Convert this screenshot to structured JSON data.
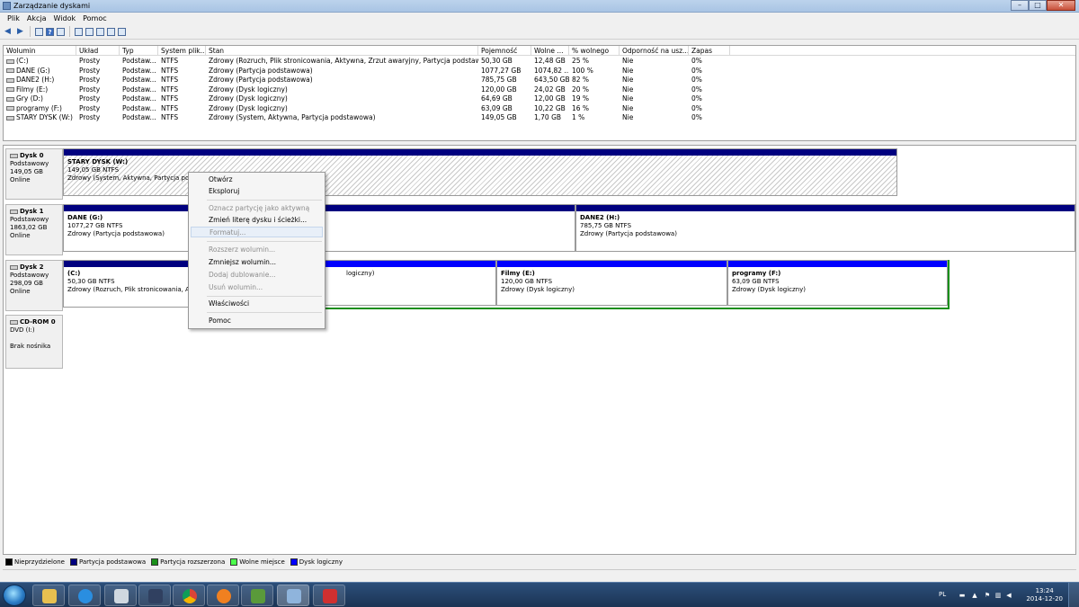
{
  "window": {
    "title": "Zarządzanie dyskami"
  },
  "menu": [
    "Plik",
    "Akcja",
    "Widok",
    "Pomoc"
  ],
  "volume_list": {
    "columns": [
      "Wolumin",
      "Układ",
      "Typ",
      "System plik...",
      "Stan",
      "Pojemność",
      "Wolne ...",
      "% wolnego",
      "Odporność na usz...",
      "Zapas"
    ],
    "rows": [
      [
        "(C:)",
        "Prosty",
        "Podstaw...",
        "NTFS",
        "Zdrowy (Rozruch, Plik stronicowania, Aktywna, Zrzut awaryjny, Partycja podstawowa)",
        "50,30 GB",
        "12,48 GB",
        "25 %",
        "Nie",
        "0%"
      ],
      [
        "DANE (G:)",
        "Prosty",
        "Podstaw...",
        "NTFS",
        "Zdrowy (Partycja podstawowa)",
        "1077,27 GB",
        "1074,82 ...",
        "100 %",
        "Nie",
        "0%"
      ],
      [
        "DANE2 (H:)",
        "Prosty",
        "Podstaw...",
        "NTFS",
        "Zdrowy (Partycja podstawowa)",
        "785,75 GB",
        "643,50 GB",
        "82 %",
        "Nie",
        "0%"
      ],
      [
        "Filmy (E:)",
        "Prosty",
        "Podstaw...",
        "NTFS",
        "Zdrowy (Dysk logiczny)",
        "120,00 GB",
        "24,02 GB",
        "20 %",
        "Nie",
        "0%"
      ],
      [
        "Gry (D:)",
        "Prosty",
        "Podstaw...",
        "NTFS",
        "Zdrowy (Dysk logiczny)",
        "64,69 GB",
        "12,00 GB",
        "19 %",
        "Nie",
        "0%"
      ],
      [
        "programy (F:)",
        "Prosty",
        "Podstaw...",
        "NTFS",
        "Zdrowy (Dysk logiczny)",
        "63,09 GB",
        "10,22 GB",
        "16 %",
        "Nie",
        "0%"
      ],
      [
        "STARY DYSK (W:)",
        "Prosty",
        "Podstaw...",
        "NTFS",
        "Zdrowy (System, Aktywna, Partycja podstawowa)",
        "149,05 GB",
        "1,70 GB",
        "1 %",
        "Nie",
        "0%"
      ]
    ]
  },
  "disks": {
    "d0": {
      "name": "Dysk 0",
      "type": "Podstawowy",
      "size": "149,05 GB",
      "status": "Online",
      "p1": {
        "name": "STARY DYSK  (W:)",
        "size": "149,05 GB NTFS",
        "status": "Zdrowy (System, Aktywna, Partycja podst"
      }
    },
    "d1": {
      "name": "Dysk 1",
      "type": "Podstawowy",
      "size": "1863,02 GB",
      "status": "Online",
      "p1": {
        "name": "DANE  (G:)",
        "size": "1077,27 GB NTFS",
        "status": "Zdrowy (Partycja podstawowa)"
      },
      "p2": {
        "name": "DANE2  (H:)",
        "size": "785,75 GB NTFS",
        "status": "Zdrowy (Partycja podstawowa)"
      }
    },
    "d2": {
      "name": "Dysk 2",
      "type": "Podstawowy",
      "size": "298,09 GB",
      "status": "Online",
      "p1": {
        "name": "(C:)",
        "size": "50,30 GB NTFS",
        "status": "Zdrowy (Rozruch, Plik stronicowania, Akt"
      },
      "p2": {
        "name": "",
        "size": "",
        "status": "logiczny)"
      },
      "p3": {
        "name": "Filmy  (E:)",
        "size": "120,00 GB NTFS",
        "status": "Zdrowy (Dysk logiczny)"
      },
      "p4": {
        "name": "programy  (F:)",
        "size": "63,09 GB NTFS",
        "status": "Zdrowy (Dysk logiczny)"
      }
    },
    "cd": {
      "name": "CD-ROM 0",
      "type": "DVD (I:)",
      "status": "Brak nośnika"
    }
  },
  "legend": [
    "Nieprzydzielone",
    "Partycja podstawowa",
    "Partycja rozszerzona",
    "Wolne miejsce",
    "Dysk logiczny"
  ],
  "legend_colors": [
    "#000000",
    "#00007f",
    "#1a8f1a",
    "#4cff4c",
    "#0000ff"
  ],
  "context_menu": {
    "items": [
      "Otwórz",
      "Eksploruj",
      "Oznacz partycję jako aktywną",
      "Zmień literę dysku i ścieżki...",
      "Formatuj...",
      "Rozszerz wolumin...",
      "Zmniejsz wolumin...",
      "Dodaj dublowanie...",
      "Usuń wolumin...",
      "Właściwości",
      "Pomoc"
    ]
  },
  "tray": {
    "lang": "PL",
    "time": "13:24",
    "date": "2014-12-20"
  }
}
